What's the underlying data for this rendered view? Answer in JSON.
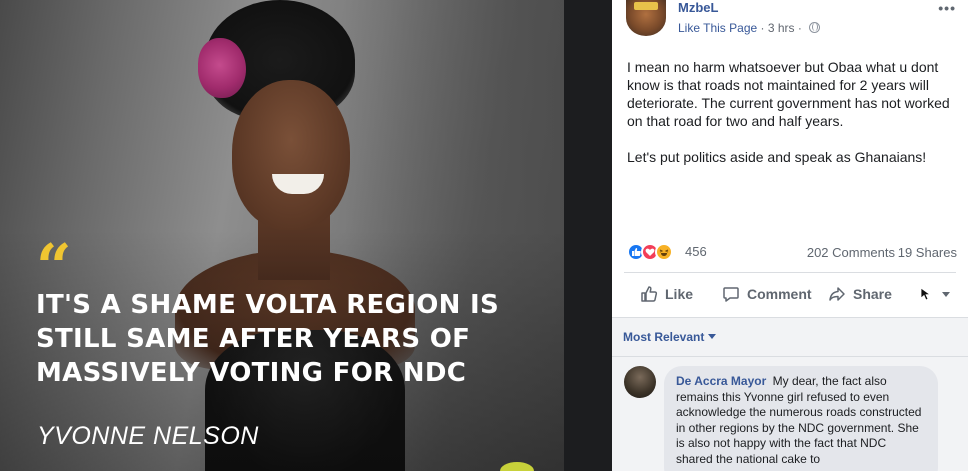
{
  "image": {
    "quote_text": "IT'S A SHAME VOLTA REGION IS STILL SAME AFTER YEARS OF MASSIVELY VOTING FOR NDC",
    "quote_author": "YVONNE NELSON",
    "quote_color": "#f0c531"
  },
  "post": {
    "page_name": "MzbeL",
    "like_link": "Like This Page",
    "time": "3 hrs",
    "paragraph1": "I mean no harm whatsoever but Obaa what u dont know is that roads not maintained for 2 years will deteriorate. The current government has not worked on that road for two and half years.",
    "paragraph2": "Let's put politics aside and speak as Ghanaians!",
    "reaction_count": "456",
    "comments_count": "202 Comments",
    "shares_count": "19 Shares"
  },
  "actions": {
    "like": "Like",
    "comment": "Comment",
    "share": "Share"
  },
  "comments": {
    "filter_label": "Most Relevant",
    "items": [
      {
        "author": "De Accra Mayor",
        "text": "My dear, the fact also remains this Yvonne girl refused to even acknowledge the numerous roads constructed in other regions by the NDC government. She is also not happy with the fact that NDC shared the national cake to"
      }
    ]
  },
  "colors": {
    "link": "#385898",
    "like_blue": "#1877f2",
    "love_red": "#f33e58",
    "haha_yellow": "#f7b125"
  }
}
